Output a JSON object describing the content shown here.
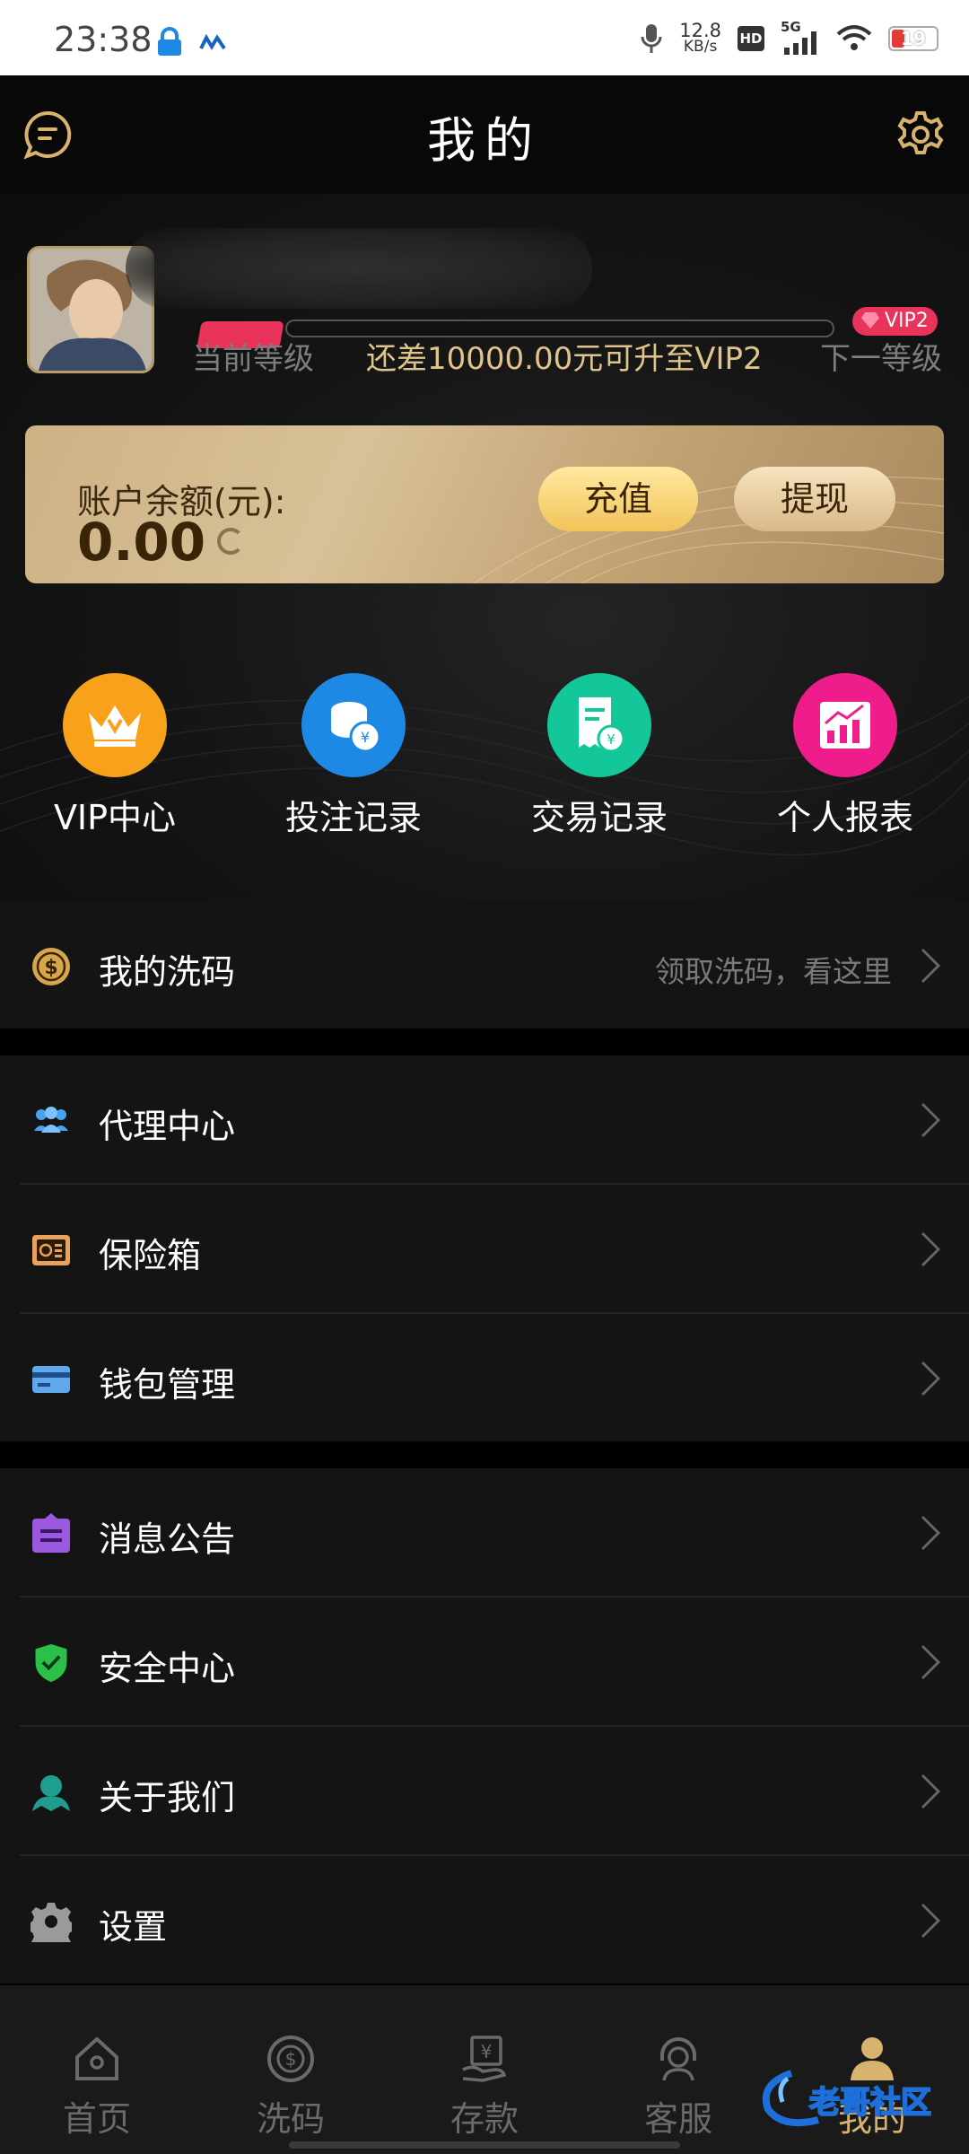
{
  "status_bar": {
    "time": "23:38",
    "speed_value": "12.8",
    "speed_unit": "KB/s",
    "hd": "HD",
    "network": "5G",
    "battery": "19"
  },
  "header": {
    "title": "我的"
  },
  "profile": {
    "current_level_label": "当前等级",
    "upgrade_hint": "还差10000.00元可升至VIP2",
    "next_level_label": "下一等级",
    "next_vip_badge": "VIP2",
    "progress": 0
  },
  "balance": {
    "label": "账户余额(元):",
    "amount": "0.00",
    "recharge_label": "充值",
    "withdraw_label": "提现"
  },
  "quick_menu": [
    {
      "label": "VIP中心",
      "color": "#f7a21a",
      "icon": "crown-icon"
    },
    {
      "label": "投注记录",
      "color": "#1e88e5",
      "icon": "coins-icon"
    },
    {
      "label": "交易记录",
      "color": "#14c79a",
      "icon": "receipt-icon"
    },
    {
      "label": "个人报表",
      "color": "#ee1d8b",
      "icon": "chart-icon"
    }
  ],
  "rebate": {
    "label": "我的洗码",
    "hint": "领取洗码，看这里"
  },
  "menu_group1": [
    {
      "label": "代理中心",
      "icon": "agent-icon"
    },
    {
      "label": "保险箱",
      "icon": "safe-icon"
    },
    {
      "label": "钱包管理",
      "icon": "wallet-icon"
    }
  ],
  "menu_group2": [
    {
      "label": "消息公告",
      "icon": "notice-icon"
    },
    {
      "label": "安全中心",
      "icon": "shield-icon"
    },
    {
      "label": "关于我们",
      "icon": "about-icon"
    },
    {
      "label": "设置",
      "icon": "gear-icon"
    }
  ],
  "bottom_nav": [
    {
      "label": "首页",
      "icon": "home-icon"
    },
    {
      "label": "洗码",
      "icon": "rebate-icon"
    },
    {
      "label": "存款",
      "icon": "deposit-icon"
    },
    {
      "label": "客服",
      "icon": "service-icon"
    },
    {
      "label": "我的",
      "icon": "user-icon"
    }
  ],
  "active_tab": "我的",
  "watermark": "老哥社区"
}
